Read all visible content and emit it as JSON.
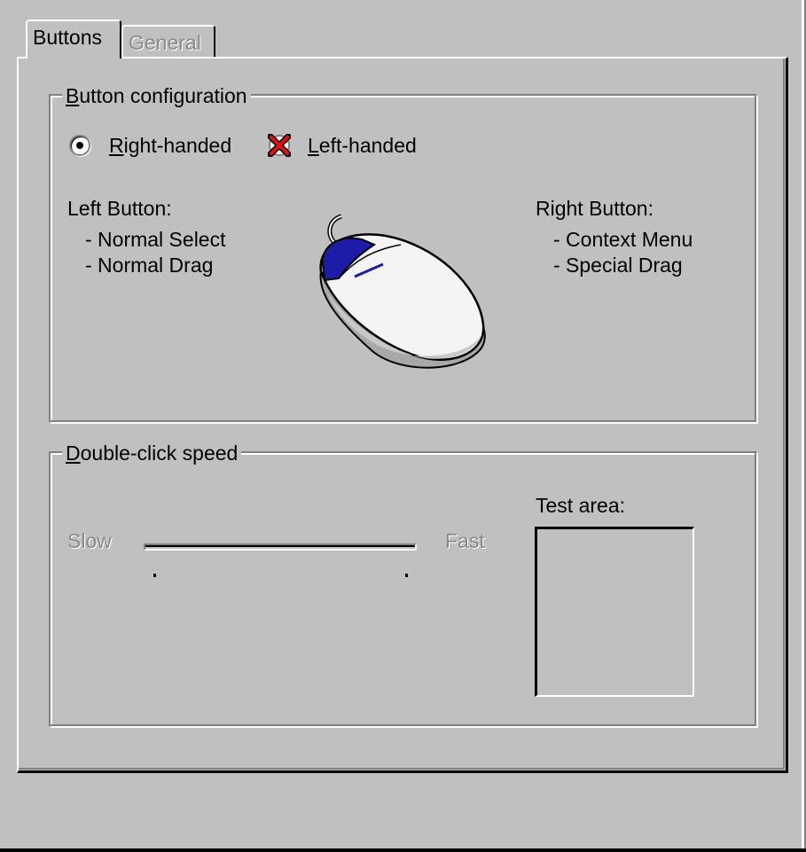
{
  "tabs": [
    {
      "label": "Buttons",
      "active": true
    },
    {
      "label": "General",
      "active": false,
      "disabled": true
    }
  ],
  "button_config": {
    "legend_first": "B",
    "legend_rest": "utton configuration",
    "right_handed": {
      "first": "R",
      "rest": "ight-handed",
      "selected": true
    },
    "left_handed": {
      "first": "L",
      "rest": "eft-handed",
      "selected": false
    },
    "left_button": {
      "title": "Left Button:",
      "items": [
        "-  Normal Select",
        "-  Normal Drag"
      ]
    },
    "right_button": {
      "title": "Right Button:",
      "items": [
        "-  Context Menu",
        "-  Special Drag"
      ]
    },
    "mouse_icon": "mouse-icon",
    "accent_color": "#1c1ca8"
  },
  "double_click": {
    "legend_first": "D",
    "legend_rest": "ouble-click speed",
    "slow_label": "Slow",
    "fast_label": "Fast",
    "test_area_label": "Test area:"
  }
}
